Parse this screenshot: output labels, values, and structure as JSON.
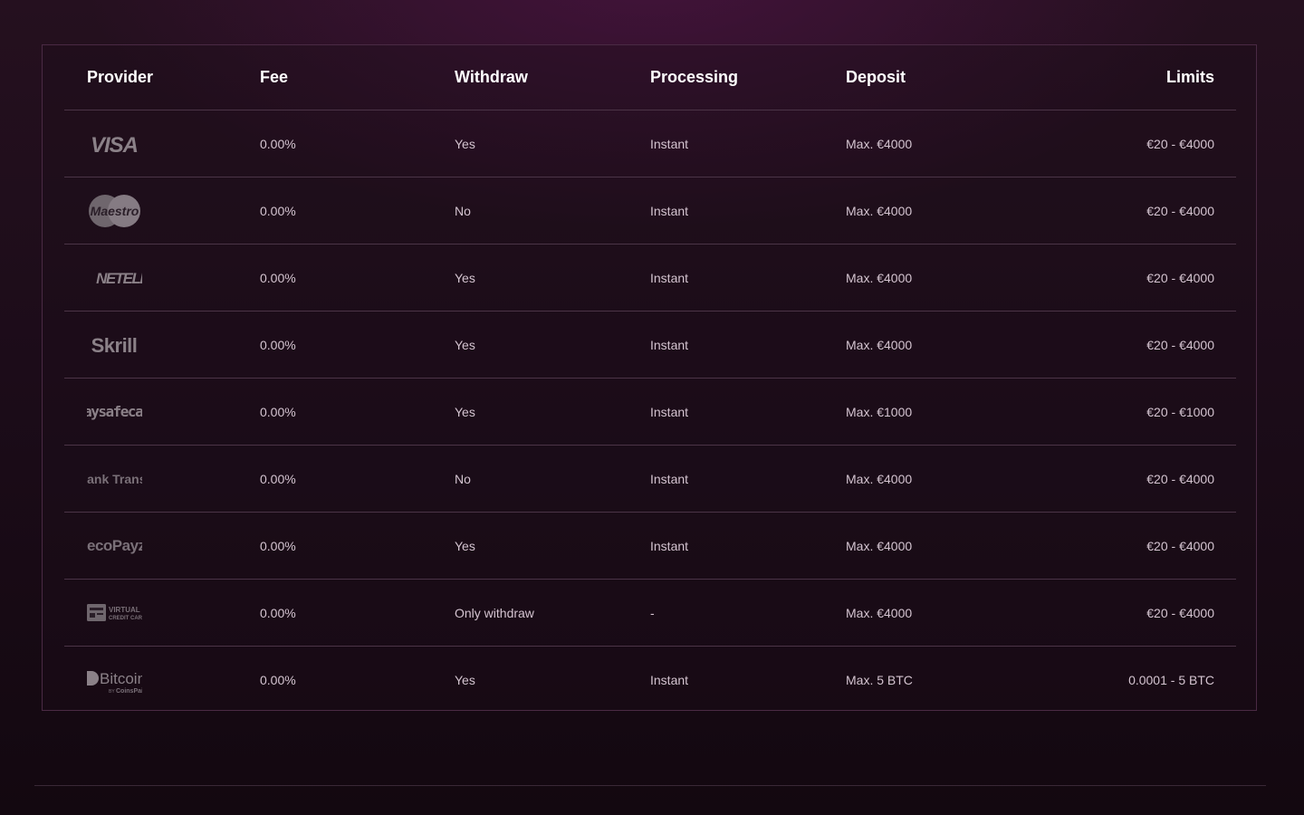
{
  "table": {
    "headers": {
      "provider": "Provider",
      "fee": "Fee",
      "withdraw": "Withdraw",
      "processing": "Processing",
      "deposit": "Deposit",
      "limits": "Limits"
    },
    "rows": [
      {
        "provider_logo": "visa-logo",
        "logo_text": "VISA",
        "fee": "0.00%",
        "withdraw": "Yes",
        "processing": "Instant",
        "deposit": "Max. €4000",
        "limits": "€20 - €4000"
      },
      {
        "provider_logo": "maestro-logo",
        "logo_text": "Maestro",
        "fee": "0.00%",
        "withdraw": "No",
        "processing": "Instant",
        "deposit": "Max. €4000",
        "limits": "€20 - €4000"
      },
      {
        "provider_logo": "neteller-logo",
        "logo_text": "NETELLER",
        "fee": "0.00%",
        "withdraw": "Yes",
        "processing": "Instant",
        "deposit": "Max. €4000",
        "limits": "€20 - €4000"
      },
      {
        "provider_logo": "skrill-logo",
        "logo_text": "Skrill",
        "fee": "0.00%",
        "withdraw": "Yes",
        "processing": "Instant",
        "deposit": "Max. €4000",
        "limits": "€20 - €4000"
      },
      {
        "provider_logo": "paysafecard-logo",
        "logo_text": "paysafecard",
        "fee": "0.00%",
        "withdraw": "Yes",
        "processing": "Instant",
        "deposit": "Max. €1000",
        "limits": "€20 - €1000"
      },
      {
        "provider_logo": "bank-transfer-logo",
        "logo_text": "Bank Transfer",
        "fee": "0.00%",
        "withdraw": "No",
        "processing": "Instant",
        "deposit": "Max. €4000",
        "limits": "€20 - €4000"
      },
      {
        "provider_logo": "ecopayz-logo",
        "logo_text": "ecoPayz",
        "fee": "0.00%",
        "withdraw": "Yes",
        "processing": "Instant",
        "deposit": "Max. €4000",
        "limits": "€20 - €4000"
      },
      {
        "provider_logo": "virtual-credit-card-logo",
        "logo_text": "VIRTUAL CREDIT CARD",
        "fee": "0.00%",
        "withdraw": "Only withdraw",
        "processing": "-",
        "deposit": "Max. €4000",
        "limits": "€20 - €4000"
      },
      {
        "provider_logo": "bitcoin-coinspaid-logo",
        "logo_text": "Bitcoin",
        "fee": "0.00%",
        "withdraw": "Yes",
        "processing": "Instant",
        "deposit": "Max. 5 BTC",
        "limits": "0.0001 - 5 BTC"
      }
    ]
  },
  "colors": {
    "header_text": "#ffffff",
    "cell_text": "#d4c4d0",
    "logo_gray": "#8b8188",
    "divider": "#4b3447",
    "frame_border": "#4a2a44"
  }
}
